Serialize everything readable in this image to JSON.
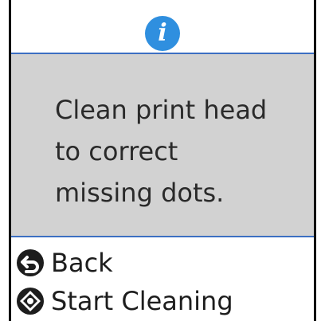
{
  "header": {
    "icon": "info-icon",
    "icon_glyph": "i",
    "icon_color": "#2f8fdf"
  },
  "message": {
    "text": "Clean print head\nto correct\nmissing dots.",
    "panel_color": "#d2d2d2"
  },
  "actions": [
    {
      "icon": "back-button-icon",
      "label": "Back"
    },
    {
      "icon": "start-button-icon",
      "label": "Start Cleaning"
    }
  ],
  "colors": {
    "divider": "#3c6fc2",
    "frame": "#111111"
  }
}
